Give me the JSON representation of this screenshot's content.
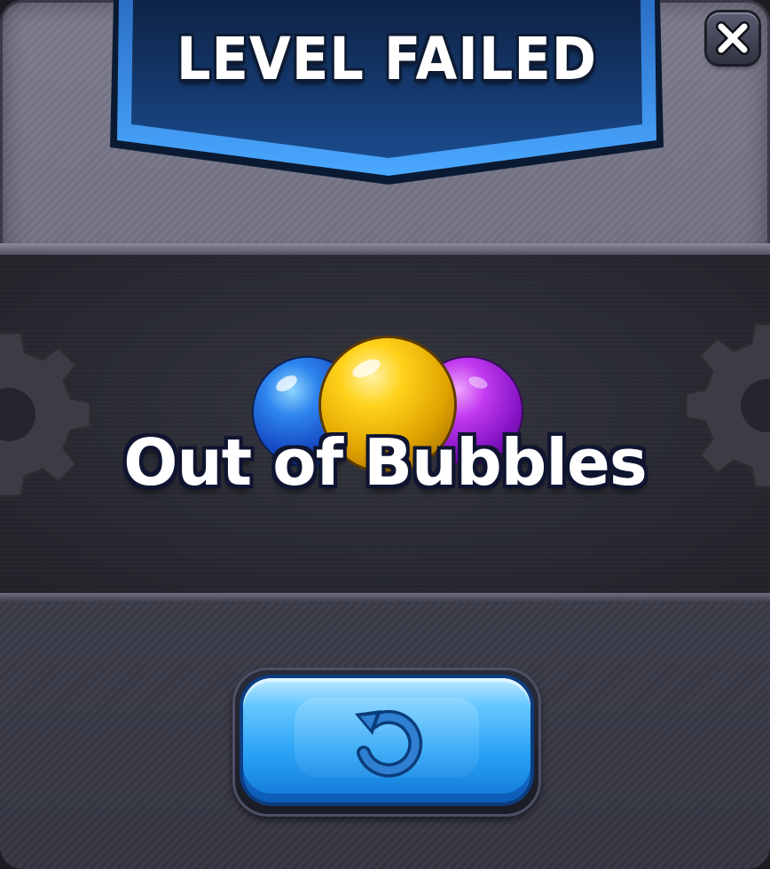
{
  "dialog": {
    "title": "LEVEL FAILED",
    "close_icon": "close-icon",
    "status_message": "Out of Bubbles",
    "bubbles": [
      {
        "color": "#1e5fe0",
        "name": "blue"
      },
      {
        "color": "#f2c20c",
        "name": "yellow"
      },
      {
        "color": "#b022e8",
        "name": "purple"
      }
    ],
    "retry_icon": "retry-icon"
  },
  "colors": {
    "banner": "#143a72",
    "button": "#2aa3f5",
    "panel": "#6e6e80",
    "content_bg": "#2a2b33"
  }
}
